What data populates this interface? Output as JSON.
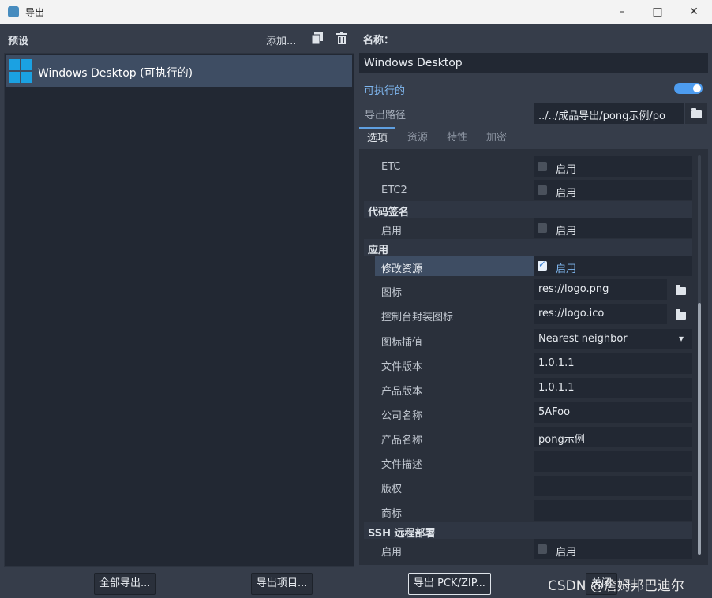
{
  "window": {
    "title": "导出",
    "minimize": "–",
    "maximize": "□",
    "close": "✕"
  },
  "presets": {
    "header": "预设",
    "add_label": "添加...",
    "items": [
      {
        "label": "Windows Desktop (可执行的)"
      }
    ]
  },
  "details": {
    "name_label": "名称：",
    "name_value": "Windows Desktop",
    "runnable_label": "可执行的",
    "runnable_on": true,
    "export_path_label": "导出路径",
    "export_path_value": "../../成品导出/pong示例/po",
    "tabs": [
      "选项",
      "资源",
      "特性",
      "加密"
    ],
    "active_tab": "选项",
    "rows": {
      "etc": {
        "label": "ETC",
        "check": "启用"
      },
      "etc2": {
        "label": "ETC2",
        "check": "启用"
      },
      "codesign_section": "代码签名",
      "codesign_enable": {
        "label": "启用",
        "check": "启用"
      },
      "app_section": "应用",
      "modify_resources": {
        "label": "修改资源",
        "check": "启用"
      },
      "icon": {
        "label": "图标",
        "value": "res://logo.png"
      },
      "console_icon": {
        "label": "控制台封装图标",
        "value": "res://logo.ico"
      },
      "icon_interp": {
        "label": "图标插值",
        "value": "Nearest neighbor"
      },
      "file_version": {
        "label": "文件版本",
        "value": "1.0.1.1"
      },
      "product_version": {
        "label": "产品版本",
        "value": "1.0.1.1"
      },
      "company_name": {
        "label": "公司名称",
        "value": "5AFoo"
      },
      "product_name": {
        "label": "产品名称",
        "value": "pong示例"
      },
      "file_desc": {
        "label": "文件描述",
        "value": ""
      },
      "copyright": {
        "label": "版权",
        "value": ""
      },
      "trademark": {
        "label": "商标",
        "value": ""
      },
      "ssh_section": "SSH 远程部署",
      "ssh_enable": {
        "label": "启用",
        "check": "启用"
      }
    }
  },
  "bottom": {
    "export_all": "全部导出...",
    "export_project": "导出项目...",
    "export_pck": "导出 PCK/ZIP...",
    "close": "关闭"
  },
  "watermark": "CSDN @詹姆邦巴迪尔"
}
